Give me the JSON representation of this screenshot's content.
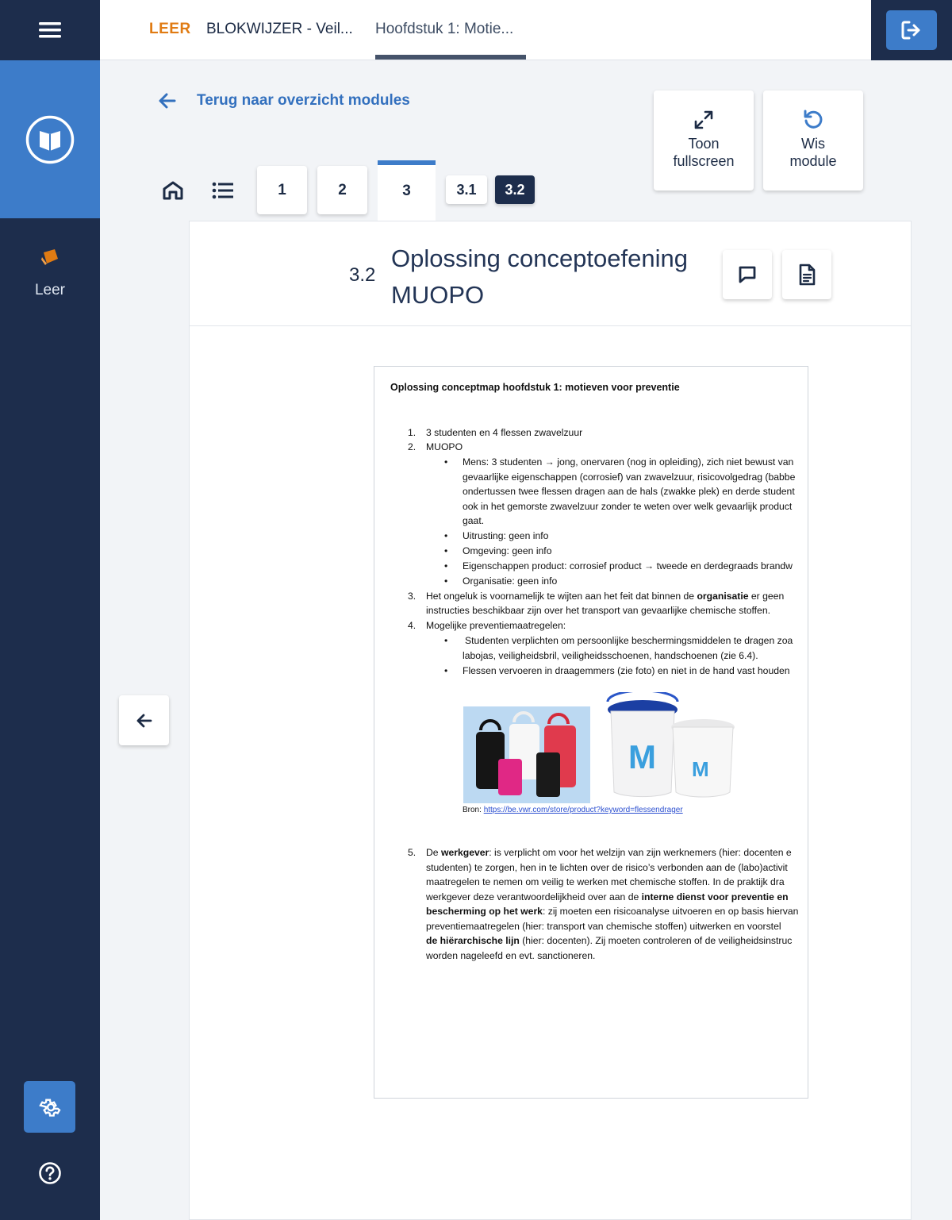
{
  "sidebar": {
    "nav_leer_label": "Leer"
  },
  "topbar": {
    "crumb_leer": "LEER",
    "crumb_blokwijzer": "BLOKWIJZER - Veil...",
    "crumb_hoofdstuk": "Hoofdstuk 1: Motie..."
  },
  "back_link": "Terug naar overzicht modules",
  "actions": {
    "fullscreen_line1": "Toon",
    "fullscreen_line2": "fullscreen",
    "wis_line1": "Wis",
    "wis_line2": "module"
  },
  "tabs": {
    "items": [
      "1",
      "2",
      "3"
    ],
    "active": "3",
    "sub_items": [
      "3.1",
      "3.2"
    ],
    "active_sub": "3.2"
  },
  "section": {
    "number": "3.2",
    "title": "Oplossing conceptoefening MUOPO"
  },
  "document": {
    "title": "Oplossing conceptmap hoofdstuk 1: motieven voor preventie",
    "n1": "1.",
    "item1": "3 studenten en 4 flessen zwavelzuur",
    "n2": "2.",
    "item2": "MUOPO",
    "mens_l1": "Mens: 3 studenten → jong, onervaren (nog in opleiding), zich niet bewust van",
    "mens_l2": "gevaarlijke eigenschappen (corrosief) van zwavelzuur, risicovolgedrag (babbe",
    "mens_l3": "ondertussen twee flessen dragen aan de hals (zwakke plek) en derde student",
    "mens_l4": "ook in het gemorste zwavelzuur zonder te weten over welk gevaarlijk product",
    "mens_l5": "gaat.",
    "uitrusting": "Uitrusting: geen info",
    "omgeving": "Omgeving: geen info",
    "eigenschappen": "Eigenschappen product: corrosief product → tweede en derdegraads brandw",
    "organisatie": "Organisatie: geen info",
    "n3": "3.",
    "item3_l1_a": "Het ongeluk is voornamelijk te wijten aan het feit dat binnen de ",
    "item3_l1_b": "organisatie",
    "item3_l1_c": " er geen",
    "item3_l2": "instructies beschikbaar zijn over het transport van gevaarlijke chemische stoffen.",
    "n4": "4.",
    "item4": "Mogelijke preventiemaatregelen:",
    "prev1_l1": "Studenten verplichten om persoonlijke beschermingsmiddelen te dragen zoa",
    "prev1_l2": "labojas, veiligheidsbril, veiligheidsschoenen, handschoenen (zie 6.4).",
    "prev2": "Flessen vervoeren in draagemmers (zie foto) en niet in de hand vast houden",
    "bucket_letter": "M",
    "source_prefix": "Bron: ",
    "source_url": "https://be.vwr.com/store/product?keyword=flessendrager",
    "n5": "5.",
    "item5_l1_a": "De ",
    "item5_l1_b": "werkgever",
    "item5_l1_c": ": is verplicht om voor het welzijn van zijn werknemers (hier: docenten e",
    "item5_l2": "studenten) te zorgen, hen in te lichten over de risico’s verbonden aan de (labo)activit",
    "item5_l3": "maatregelen te nemen om veilig te werken met chemische stoffen. In de praktijk dra",
    "item5_l4_a": "werkgever deze verantwoordelijkheid over aan de ",
    "item5_l4_b": "interne dienst voor preventie en",
    "item5_l5_a": "bescherming op het werk",
    "item5_l5_b": ": zij moeten een risicoanalyse uitvoeren en op basis hiervan",
    "item5_l6": "preventiemaatregelen (hier: transport van chemische stoffen) uitwerken en voorstel",
    "item5_l7_a": "de hiërarchische lijn",
    "item5_l7_b": " (hier: docenten). Zij moeten controleren of de veiligheidsinstruc",
    "item5_l8": "worden nageleefd en evt. sanctioneren."
  },
  "colors": {
    "sidebar": "#1d2d4c",
    "accent": "#3d7cc9",
    "leer_orange": "#e07b13"
  }
}
